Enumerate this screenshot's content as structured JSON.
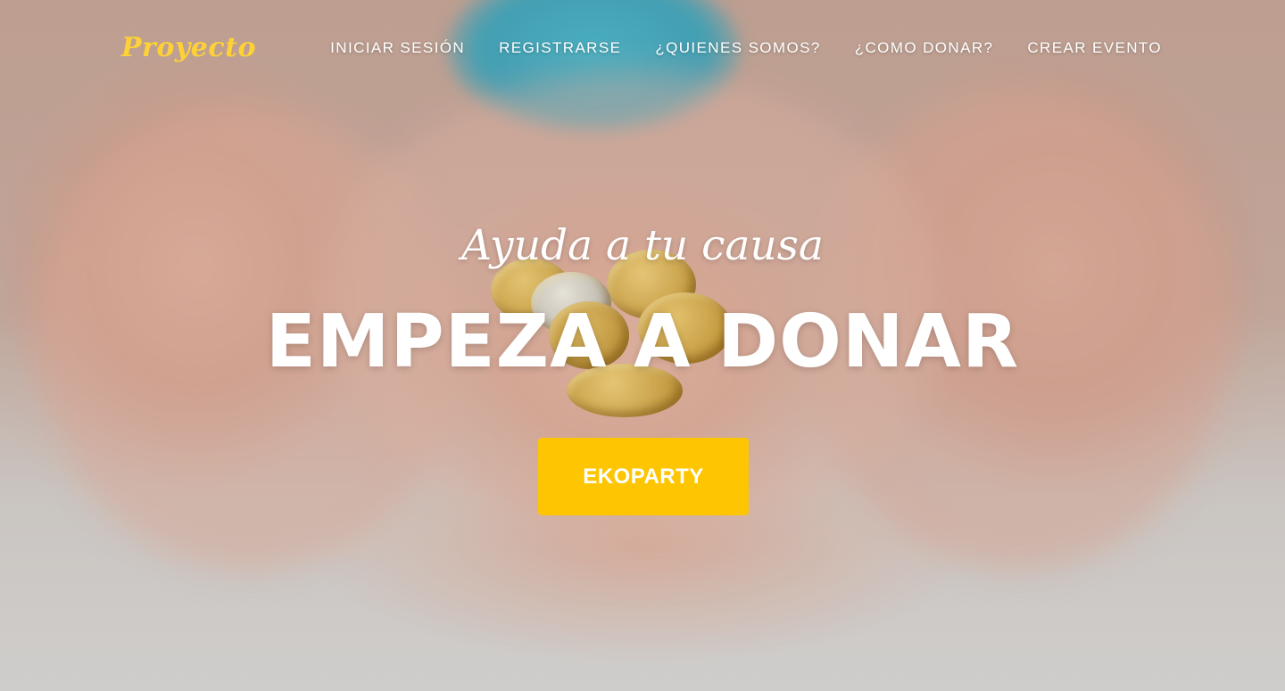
{
  "nav": {
    "brand": "Proyecto",
    "items": [
      {
        "label": "INICIAR SESIÓN"
      },
      {
        "label": "REGISTRARSE"
      },
      {
        "label": "¿QUIENES SOMOS?"
      },
      {
        "label": "¿COMO DONAR?"
      },
      {
        "label": "CREAR EVENTO"
      }
    ]
  },
  "hero": {
    "lead": "Ayuda a tu causa",
    "heading": "EMPEZA A DONAR",
    "button_label": "EKOPARTY",
    "background_image": "hands-holding-coins-photo"
  },
  "colors": {
    "brand": "#fed136",
    "button": "#fec503",
    "text": "#ffffff"
  }
}
